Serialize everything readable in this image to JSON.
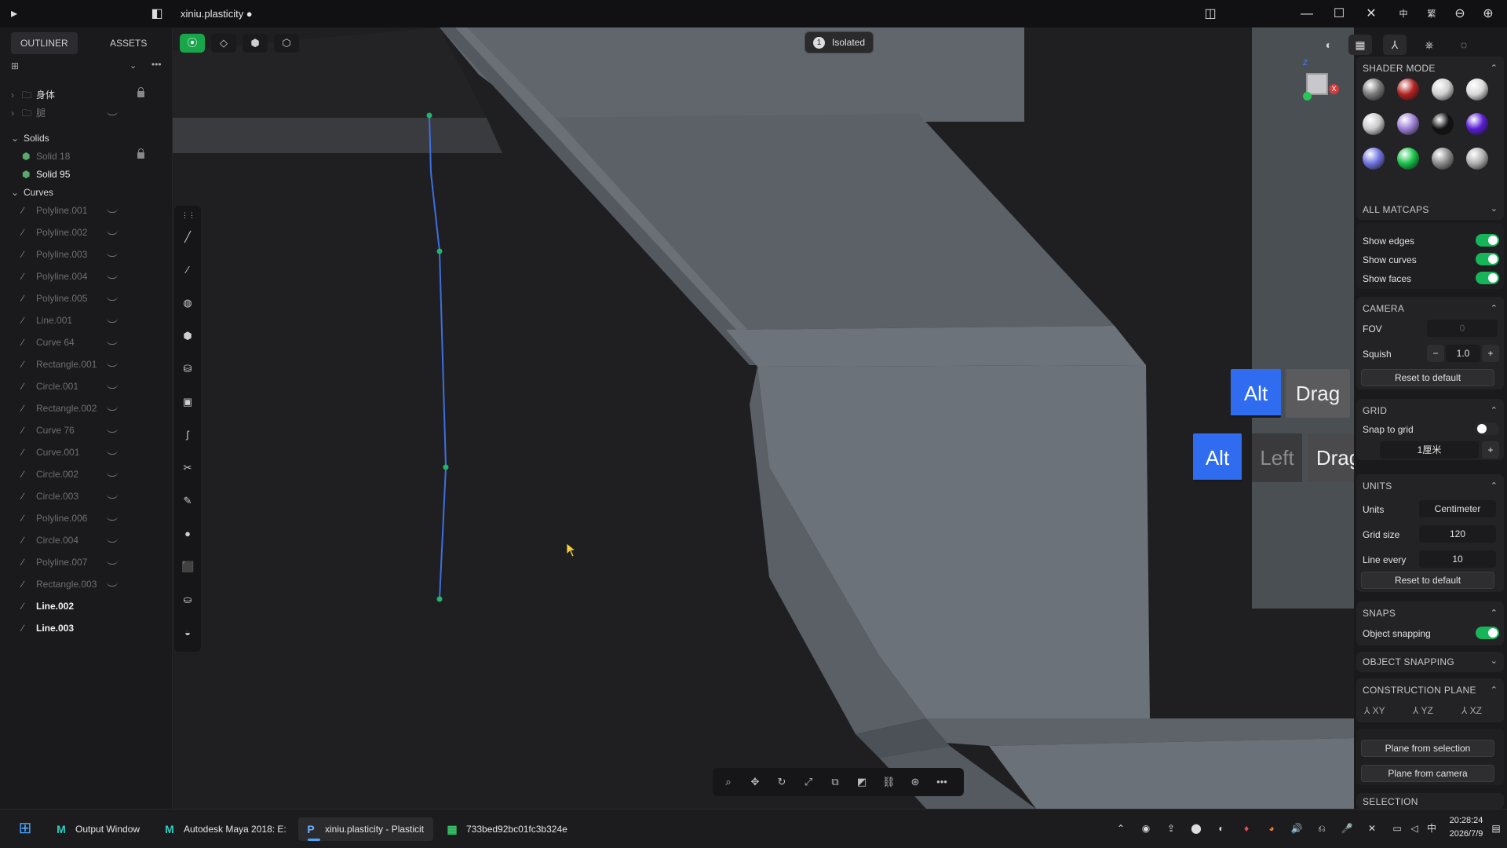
{
  "app": {
    "title": "xiniu.plasticity ●"
  },
  "outliner": {
    "tabs": [
      "OUTLINER",
      "ASSETS"
    ],
    "groups": [
      {
        "label": "身体"
      },
      {
        "label": "腿"
      }
    ],
    "solids_label": "Solids",
    "solids": [
      "Solid 18",
      "Solid 95"
    ],
    "curves_label": "Curves",
    "curves": [
      "Polyline.001",
      "Polyline.002",
      "Polyline.003",
      "Polyline.004",
      "Polyline.005",
      "Line.001",
      "Curve 64",
      "Rectangle.001",
      "Circle.001",
      "Rectangle.002",
      "Curve 76",
      "Curve.001",
      "Circle.002",
      "Circle.003",
      "Polyline.006",
      "Circle.004",
      "Polyline.007",
      "Rectangle.003",
      "Line.002",
      "Line.003"
    ]
  },
  "viewport": {
    "isolated_count": "1",
    "isolated_label": "Isolated",
    "axis_labels": {
      "z": "Z",
      "x": "X"
    }
  },
  "key_overlay": {
    "row1": [
      "Alt",
      "Drag"
    ],
    "row2": [
      "Alt",
      "Left",
      "Drag"
    ]
  },
  "right_panel": {
    "shader_mode": "SHADER MODE",
    "matcap_colors": [
      "#7a7a7a",
      "#b32222",
      "#cfcfcf",
      "#d9d9d9",
      "#c9c9c9",
      "#9b7fd6",
      "#121212",
      "#5a1fd6",
      "#6f73e0",
      "#19c24a",
      "#8c8c8c",
      "#b0b0b0"
    ],
    "all_matcaps": "ALL MATCAPS",
    "show_edges": "Show edges",
    "show_curves": "Show curves",
    "show_faces": "Show faces",
    "camera": "CAMERA",
    "fov_label": "FOV",
    "fov_value": "0",
    "squish_label": "Squish",
    "squish_value": "1.0",
    "reset_default": "Reset to default",
    "grid": "GRID",
    "snap_to_grid": "Snap to grid",
    "grid_value": "1厘米",
    "units_head": "UNITS",
    "units_label": "Units",
    "units_value": "Centimeter",
    "grid_size_label": "Grid size",
    "grid_size_value": "120",
    "line_every_label": "Line every",
    "line_every_value": "10",
    "snaps": "SNAPS",
    "object_snapping": "Object snapping",
    "object_snapping_head": "OBJECT SNAPPING",
    "construction_plane": "CONSTRUCTION PLANE",
    "planes": [
      "XY",
      "YZ",
      "XZ"
    ],
    "plane_from_selection": "Plane from selection",
    "plane_from_camera": "Plane from camera",
    "selection": "SELECTION"
  },
  "taskbar": {
    "apps": [
      {
        "label": "Output Window",
        "icon": "M"
      },
      {
        "label": "Autodesk Maya 2018: E:",
        "icon": "M"
      },
      {
        "label": "xiniu.plasticity - Plasticit",
        "icon": "P"
      },
      {
        "label": "733bed92bc01fc3b324e",
        "icon": "▦"
      }
    ],
    "time": "20:28:24",
    "date": "2026/7/9",
    "ime": "中"
  }
}
